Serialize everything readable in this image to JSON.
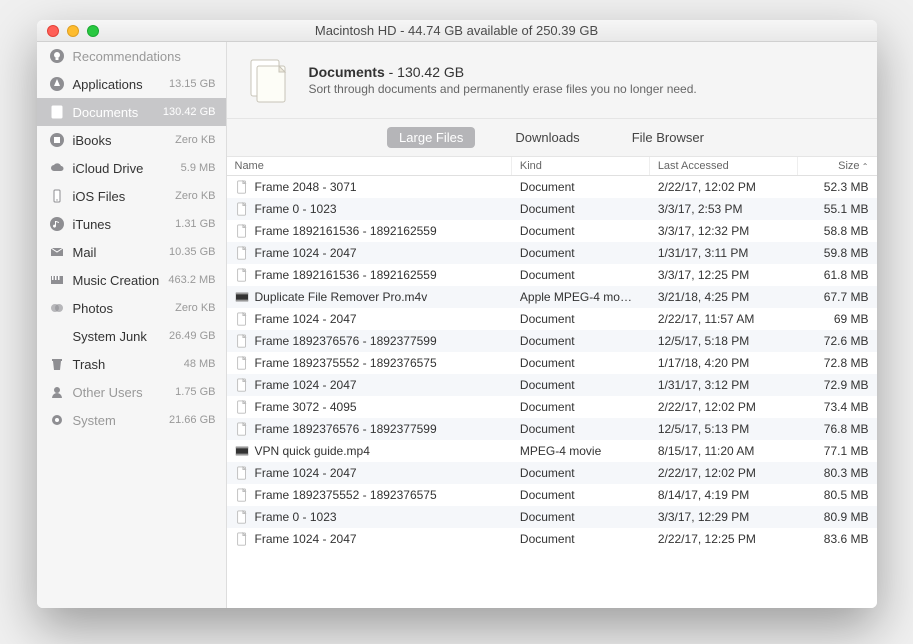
{
  "window": {
    "title": "Macintosh HD - 44.74 GB available of 250.39 GB"
  },
  "sidebar": {
    "items": [
      {
        "label": "Recommendations",
        "size": "",
        "icon": "lightbulb",
        "dim": true
      },
      {
        "label": "Applications",
        "size": "13.15 GB",
        "icon": "app"
      },
      {
        "label": "Documents",
        "size": "130.42 GB",
        "icon": "doc",
        "active": true
      },
      {
        "label": "iBooks",
        "size": "Zero KB",
        "icon": "book"
      },
      {
        "label": "iCloud Drive",
        "size": "5.9 MB",
        "icon": "cloud"
      },
      {
        "label": "iOS Files",
        "size": "Zero KB",
        "icon": "phone"
      },
      {
        "label": "iTunes",
        "size": "1.31 GB",
        "icon": "music"
      },
      {
        "label": "Mail",
        "size": "10.35 GB",
        "icon": "mail"
      },
      {
        "label": "Music Creation",
        "size": "463.2 MB",
        "icon": "piano"
      },
      {
        "label": "Photos",
        "size": "Zero KB",
        "icon": "photos"
      },
      {
        "label": "System Junk",
        "size": "26.49 GB",
        "icon": "none"
      },
      {
        "label": "Trash",
        "size": "48 MB",
        "icon": "trash"
      },
      {
        "label": "Other Users",
        "size": "1.75 GB",
        "icon": "user",
        "dim": true
      },
      {
        "label": "System",
        "size": "21.66 GB",
        "icon": "gear",
        "dim": true
      }
    ]
  },
  "banner": {
    "title_prefix": "Documents",
    "title_size": " - 130.42 GB",
    "subtitle": "Sort through documents and permanently erase files you no longer need."
  },
  "tabs": [
    {
      "label": "Large Files",
      "active": true
    },
    {
      "label": "Downloads"
    },
    {
      "label": "File Browser"
    }
  ],
  "table": {
    "columns": [
      {
        "label": "Name"
      },
      {
        "label": "Kind"
      },
      {
        "label": "Last Accessed"
      },
      {
        "label": "Size",
        "sort": "asc"
      }
    ],
    "rows": [
      {
        "name": "Frame 2048 - 3071",
        "kind": "Document",
        "last": "2/22/17, 12:02 PM",
        "size": "52.3 MB",
        "icon": "doc"
      },
      {
        "name": "Frame 0 - 1023",
        "kind": "Document",
        "last": "3/3/17, 2:53 PM",
        "size": "55.1 MB",
        "icon": "doc"
      },
      {
        "name": "Frame 1892161536 - 1892162559",
        "kind": "Document",
        "last": "3/3/17, 12:32 PM",
        "size": "58.8 MB",
        "icon": "doc"
      },
      {
        "name": "Frame 1024 - 2047",
        "kind": "Document",
        "last": "1/31/17, 3:11 PM",
        "size": "59.8 MB",
        "icon": "doc"
      },
      {
        "name": "Frame 1892161536 - 1892162559",
        "kind": "Document",
        "last": "3/3/17, 12:25 PM",
        "size": "61.8 MB",
        "icon": "doc"
      },
      {
        "name": "Duplicate File Remover Pro.m4v",
        "kind": "Apple MPEG-4 mo…",
        "last": "3/21/18, 4:25 PM",
        "size": "67.7 MB",
        "icon": "video"
      },
      {
        "name": "Frame 1024 - 2047",
        "kind": "Document",
        "last": "2/22/17, 11:57 AM",
        "size": "69 MB",
        "icon": "doc"
      },
      {
        "name": "Frame 1892376576 - 1892377599",
        "kind": "Document",
        "last": "12/5/17, 5:18 PM",
        "size": "72.6 MB",
        "icon": "doc"
      },
      {
        "name": "Frame 1892375552 - 1892376575",
        "kind": "Document",
        "last": "1/17/18, 4:20 PM",
        "size": "72.8 MB",
        "icon": "doc"
      },
      {
        "name": "Frame 1024 - 2047",
        "kind": "Document",
        "last": "1/31/17, 3:12 PM",
        "size": "72.9 MB",
        "icon": "doc"
      },
      {
        "name": "Frame 3072 - 4095",
        "kind": "Document",
        "last": "2/22/17, 12:02 PM",
        "size": "73.4 MB",
        "icon": "doc"
      },
      {
        "name": "Frame 1892376576 - 1892377599",
        "kind": "Document",
        "last": "12/5/17, 5:13 PM",
        "size": "76.8 MB",
        "icon": "doc"
      },
      {
        "name": "VPN quick guide.mp4",
        "kind": "MPEG-4 movie",
        "last": "8/15/17, 11:20 AM",
        "size": "77.1 MB",
        "icon": "video"
      },
      {
        "name": "Frame 1024 - 2047",
        "kind": "Document",
        "last": "2/22/17, 12:02 PM",
        "size": "80.3 MB",
        "icon": "doc"
      },
      {
        "name": "Frame 1892375552 - 1892376575",
        "kind": "Document",
        "last": "8/14/17, 4:19 PM",
        "size": "80.5 MB",
        "icon": "doc"
      },
      {
        "name": "Frame 0 - 1023",
        "kind": "Document",
        "last": "3/3/17, 12:29 PM",
        "size": "80.9 MB",
        "icon": "doc"
      },
      {
        "name": "Frame 1024 - 2047",
        "kind": "Document",
        "last": "2/22/17, 12:25 PM",
        "size": "83.6 MB",
        "icon": "doc"
      }
    ]
  }
}
